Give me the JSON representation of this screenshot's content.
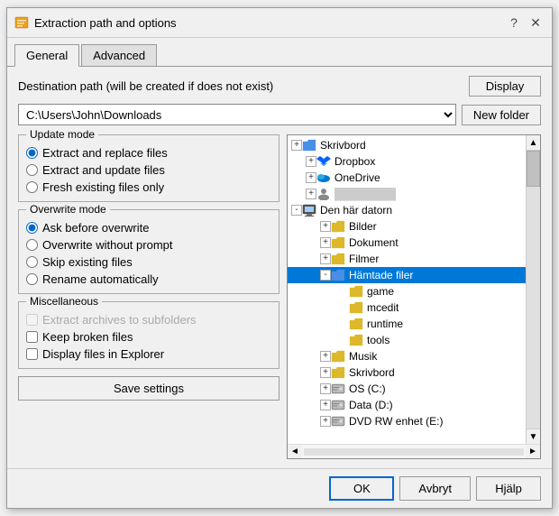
{
  "dialog": {
    "title": "Extraction path and options",
    "help_btn": "?",
    "close_btn": "✕"
  },
  "tabs": [
    {
      "label": "General",
      "active": true
    },
    {
      "label": "Advanced",
      "active": false
    }
  ],
  "destination": {
    "label": "Destination path (will be created if does not exist)",
    "display_btn": "Display",
    "new_folder_btn": "New folder",
    "path": "C:\\Users\\John\\Downloads"
  },
  "update_mode": {
    "title": "Update mode",
    "options": [
      {
        "label": "Extract and replace files",
        "checked": true
      },
      {
        "label": "Extract and update files",
        "checked": false
      },
      {
        "label": "Fresh existing files only",
        "checked": false
      }
    ]
  },
  "overwrite_mode": {
    "title": "Overwrite mode",
    "options": [
      {
        "label": "Ask before overwrite",
        "checked": true
      },
      {
        "label": "Overwrite without prompt",
        "checked": false
      },
      {
        "label": "Skip existing files",
        "checked": false
      },
      {
        "label": "Rename automatically",
        "checked": false
      }
    ]
  },
  "miscellaneous": {
    "title": "Miscellaneous",
    "options": [
      {
        "label": "Extract archives to subfolders",
        "checked": false,
        "disabled": true
      },
      {
        "label": "Keep broken files",
        "checked": false,
        "disabled": false
      },
      {
        "label": "Display files in Explorer",
        "checked": false,
        "disabled": false
      }
    ]
  },
  "save_btn": "Save settings",
  "tree": {
    "items": [
      {
        "label": "Skrivbord",
        "indent": 0,
        "type": "folder-blue",
        "expand": "+",
        "selected": false
      },
      {
        "label": "Dropbox",
        "indent": 1,
        "type": "dropbox",
        "expand": "+",
        "selected": false
      },
      {
        "label": "OneDrive",
        "indent": 1,
        "type": "onedrive",
        "expand": "+",
        "selected": false
      },
      {
        "label": "████████",
        "indent": 1,
        "type": "user",
        "expand": "+",
        "selected": false
      },
      {
        "label": "Den här datorn",
        "indent": 0,
        "type": "pc",
        "expand": "-",
        "selected": false
      },
      {
        "label": "Bilder",
        "indent": 2,
        "type": "folder",
        "expand": "+",
        "selected": false
      },
      {
        "label": "Dokument",
        "indent": 2,
        "type": "folder",
        "expand": "+",
        "selected": false
      },
      {
        "label": "Filmer",
        "indent": 2,
        "type": "folder-special",
        "expand": "+",
        "selected": false
      },
      {
        "label": "Hämtade filer",
        "indent": 2,
        "type": "folder-blue",
        "expand": "-",
        "selected": true
      },
      {
        "label": "game",
        "indent": 3,
        "type": "folder",
        "expand": " ",
        "selected": false
      },
      {
        "label": "mcedit",
        "indent": 3,
        "type": "folder",
        "expand": " ",
        "selected": false
      },
      {
        "label": "runtime",
        "indent": 3,
        "type": "folder",
        "expand": " ",
        "selected": false
      },
      {
        "label": "tools",
        "indent": 3,
        "type": "folder",
        "expand": " ",
        "selected": false
      },
      {
        "label": "Musik",
        "indent": 2,
        "type": "folder-music",
        "expand": "+",
        "selected": false
      },
      {
        "label": "Skrivbord",
        "indent": 2,
        "type": "folder",
        "expand": "+",
        "selected": false
      },
      {
        "label": "OS (C:)",
        "indent": 2,
        "type": "drive",
        "expand": "+",
        "selected": false
      },
      {
        "label": "Data (D:)",
        "indent": 2,
        "type": "drive",
        "expand": "+",
        "selected": false
      },
      {
        "label": "DVD RW enhet (E:)",
        "indent": 2,
        "type": "drive",
        "expand": "+",
        "selected": false
      }
    ]
  },
  "footer": {
    "ok_btn": "OK",
    "cancel_btn": "Avbryt",
    "help_btn": "Hjälp"
  }
}
